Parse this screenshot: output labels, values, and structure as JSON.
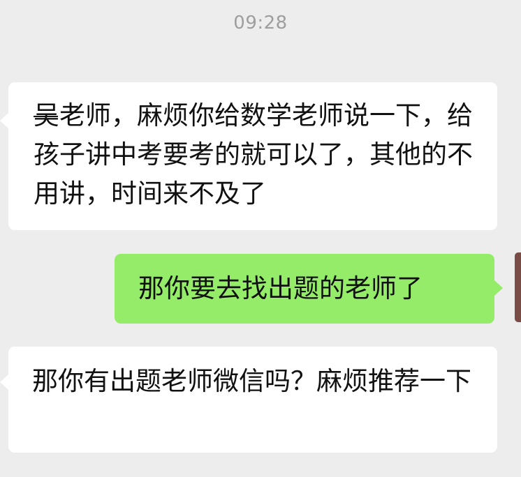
{
  "chat": {
    "timestamp": "09:28",
    "messages": [
      {
        "direction": "incoming",
        "text_first_char": "吴",
        "text_rest": "老师，麻烦你给数学老师说一下，给孩子讲中考要考的就可以了，其他的不用讲，时间来不及了"
      },
      {
        "direction": "outgoing",
        "text": "那你要去找出题的老师了"
      },
      {
        "direction": "incoming",
        "text": "那你有出题老师微信吗？麻烦推荐一下"
      }
    ]
  },
  "colors": {
    "background": "#ededed",
    "incoming_bubble": "#ffffff",
    "outgoing_bubble": "#95ec69",
    "timestamp_text": "#9e9e9e"
  }
}
